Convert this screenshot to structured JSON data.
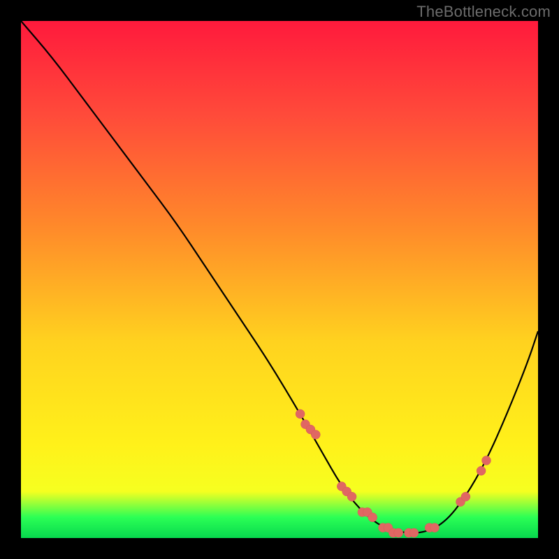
{
  "watermark": "TheBottleneck.com",
  "colors": {
    "background_frame": "#000000",
    "gradient_top": "#ff1a3c",
    "gradient_mid1": "#ff8a2a",
    "gradient_mid2": "#fff11a",
    "gradient_bottom": "#07d84e",
    "curve": "#000000",
    "dots": "#e06763"
  },
  "chart_data": {
    "type": "line",
    "title": "",
    "xlabel": "",
    "ylabel": "",
    "xlim": [
      0,
      100
    ],
    "ylim": [
      0,
      100
    ],
    "grid": false,
    "legend": false,
    "series": [
      {
        "name": "bottleneck-curve",
        "x": [
          0,
          6,
          12,
          18,
          24,
          30,
          36,
          42,
          48,
          54,
          58,
          62,
          66,
          70,
          74,
          78,
          82,
          86,
          90,
          94,
          98,
          100
        ],
        "y": [
          100,
          93,
          85,
          77,
          69,
          61,
          52,
          43,
          34,
          24,
          17,
          10,
          5,
          2,
          1,
          1,
          3,
          8,
          15,
          24,
          34,
          40
        ]
      }
    ],
    "highlight_points": {
      "name": "marker-dots",
      "x": [
        54,
        55,
        56,
        57,
        62,
        63,
        64,
        66,
        67,
        68,
        70,
        71,
        72,
        73,
        75,
        76,
        79,
        80,
        85,
        86,
        89,
        90
      ],
      "y": [
        24,
        22,
        21,
        20,
        10,
        9,
        8,
        5,
        5,
        4,
        2,
        2,
        1,
        1,
        1,
        1,
        2,
        2,
        7,
        8,
        13,
        15
      ]
    }
  }
}
